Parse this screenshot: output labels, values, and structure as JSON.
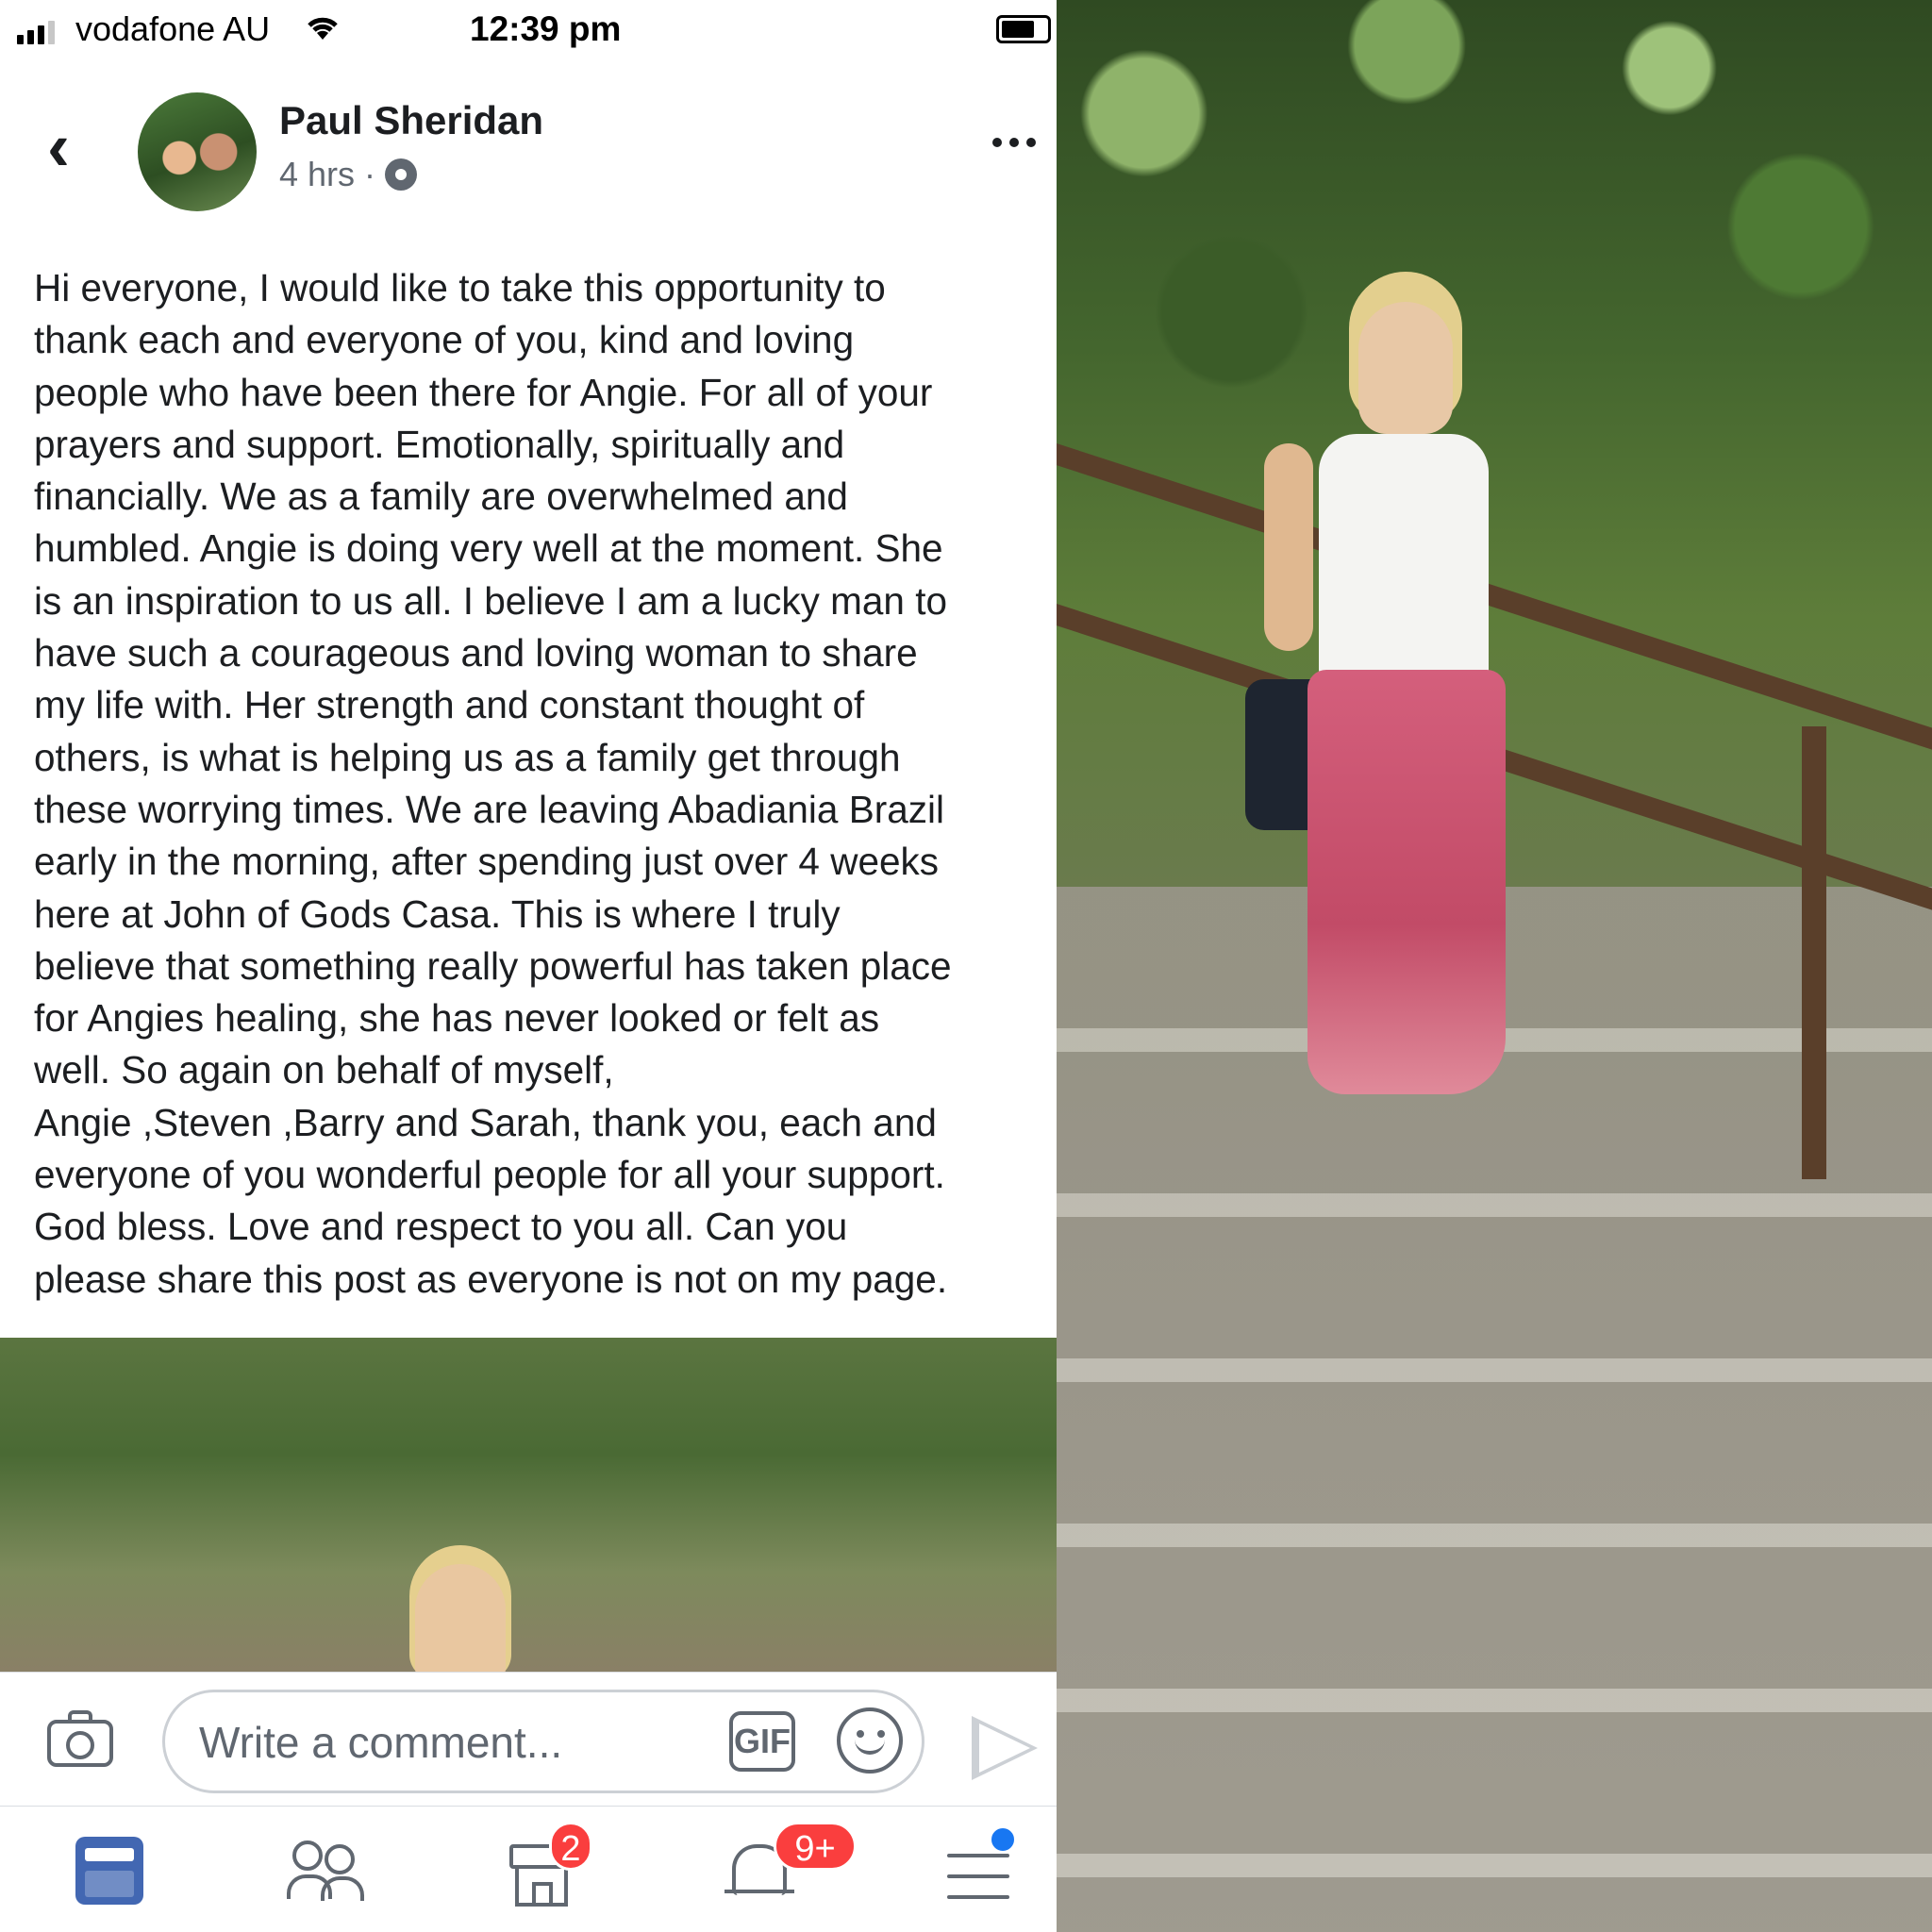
{
  "status_bar": {
    "carrier": "vodafone AU",
    "time": "12:39 pm"
  },
  "post": {
    "author": "Paul Sheridan",
    "time_ago": "4 hrs",
    "separator": "·",
    "text": "Hi everyone, I would like to take this opportunity to\nthank each and everyone of you, kind and loving\npeople who have been there for Angie.  For all of your\nprayers and support. Emotionally, spiritually and\nfinancially. We as a family are overwhelmed and\nhumbled. Angie is doing very well at the moment. She\nis an inspiration to us all. I believe I am a lucky man to\nhave such a courageous and loving woman to share\nmy life with. Her strength and constant thought of\nothers, is what is helping us as a family get through\nthese worrying times. We are leaving Abadiania Brazil\nearly in the morning, after spending just over 4 weeks\nhere at John of Gods Casa. This is where I truly\nbelieve that something really powerful has taken place\nfor Angies  healing, she has never looked or felt as\nwell. So again on behalf of myself,\nAngie ,Steven ,Barry and Sarah, thank you, each and\neveryone of you wonderful people for all your support.\nGod bless. Love and respect to you all. Can you\nplease share this post as everyone is not on my page."
  },
  "comment_bar": {
    "placeholder": "Write a comment...",
    "gif_label": "GIF"
  },
  "tab_bar": {
    "marketplace_badge": "2",
    "notifications_badge": "9+"
  },
  "icons": [
    "back-chevron-icon",
    "gear-icon",
    "more-options-icon",
    "camera-icon",
    "gif-icon",
    "emoji-icon",
    "send-icon",
    "news-feed-icon",
    "friends-icon",
    "marketplace-icon",
    "notifications-icon",
    "menu-icon"
  ],
  "colors": {
    "accent": "#4267b2",
    "badge": "#fa3e3e",
    "text": "#1c1e21",
    "secondary_text": "#606770"
  }
}
